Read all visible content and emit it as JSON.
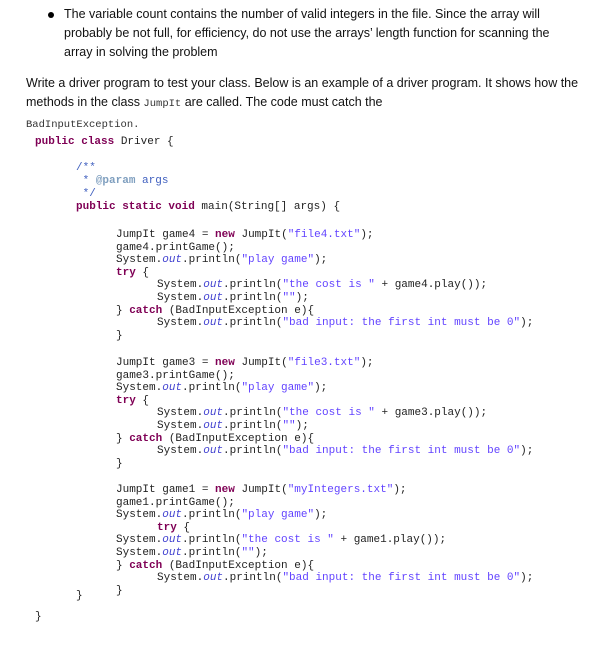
{
  "bullet": {
    "text": "The variable count contains the number of valid integers in the file. Since the array will probably be not full, for efficiency, do not use the arrays’ length function for scanning the array in solving the problem"
  },
  "paragraph": {
    "part1": "Write a driver program to test your class.  Below is an example of a driver program. It shows how the methods in the class ",
    "class_name": "JumpIt",
    "part2": "  are called.  The code must catch the ",
    "exception_name": "BadInputException",
    "part3": "."
  },
  "code": {
    "class_decl": {
      "kw": "public class",
      "rest": " Driver {"
    },
    "javadoc": {
      "open": "/**",
      "star": " * ",
      "tag": "@param",
      "arg": " args",
      "close": " */"
    },
    "main_decl": {
      "kw": "public static void",
      "rest": " main(String[] args) {"
    },
    "blocks": [
      {
        "var": "game4",
        "file": "\"file4.txt\"",
        "try_indented": false
      },
      {
        "var": "game3",
        "file": "\"file3.txt\"",
        "try_indented": false
      },
      {
        "var": "game1",
        "file": "\"myIntegers.txt\"",
        "try_indented": true
      }
    ],
    "tokens": {
      "type": "JumpIt",
      "new": "new",
      "print_game": ".printGame();",
      "system": "System.",
      "out": "out",
      "println": ".println(",
      "play_game_str": "\"play game\"",
      "close_stmt": ");",
      "try": "try",
      "catch": "catch",
      "cost_str": "\"the cost is \"",
      "play_call": ".play());",
      "empty_str": "\"\"",
      "catch_rest": " (BadInputException e){",
      "bad_input_str": "\"bad input: the first int must be 0\"",
      "open_brace": " {",
      "close_brace": "}",
      "close_catch_open": "} "
    }
  }
}
